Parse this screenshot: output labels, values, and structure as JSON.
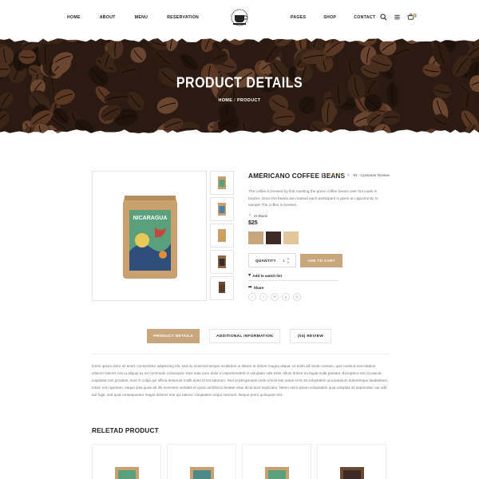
{
  "nav": {
    "left": [
      "HOME",
      "ABOUT",
      "MENU",
      "RESERVATION"
    ],
    "right": [
      "PAGES",
      "SHOP",
      "CONTACT"
    ],
    "icons": [
      "search-icon",
      "menu-icon",
      "cart-icon"
    ],
    "cart_count": "0"
  },
  "banner": {
    "title": "PRODUCT DETAILS",
    "crumb_home": "HOME",
    "crumb_sep": " / ",
    "crumb_current": "PRODUCT"
  },
  "product": {
    "title": "AMERICANO COFFEE BEANS",
    "rating": 3,
    "rating_text": "04 - Customer Review",
    "description": "The coffee is brewed by first roasting the green coffee beans over hot coals in brazier. Once the beans are roasted each participant is given an opportunity to sample The coffee is brewed...",
    "stock": "In Stock",
    "price": "$25",
    "swatches": [
      "#c9a77d",
      "#3b2a26",
      "#e3c79b"
    ],
    "quantity_label": "QUANTITY",
    "quantity_value": "1",
    "add_to_cart": "ADD TO CART",
    "wishlist": "Add to watch list",
    "share": "Share",
    "socials": [
      "twitter-icon",
      "facebook-icon",
      "email-icon",
      "google-plus-icon",
      "link-icon"
    ],
    "package_text": "NICARAGUA"
  },
  "tabs": {
    "items": [
      "PRODUCT DETAILS",
      "ADDITIONAL INFORMATION",
      "(04) REVIEW"
    ],
    "active": 0,
    "body": "lorem ipsum dolor sit amet, consectetur adipisicing elit, sed do eiusmod tempor incididunt ut labore et dolore magna aliqua. Ut enim ad minim veniam, quis nostrud exercitation ullamco laboris nisi ut aliquip ex ea commodo consequat. Duis aute irure dolor in reprehenderit in voluptate velit esse cillum dolore eu fugiat nulla pariatur. Excepteur sint occaecat cupidatat non proident, sunt in culpa qui officia deserunt mollit anim id est laborum. Sed ut perspiciatis unde omnis iste natus error sit voluptatem accusantium doloremque laudantium, totam rem aperiam, eaque ipsa quae ab illo inventore veritatis et quasi architecto beatae vitae dicta sunt explicabo. Nemo enim ipsam voluptatem quia voluptas sit aspernatur aut odit aut fugit, sed quia consequuntur magni dolores eos qui ratione voluptatem sequi nesciunt. Neque porro quisquam est."
  },
  "related": {
    "title": "RELETAD PRODUCT"
  },
  "colors": {
    "accent": "#c9a77d",
    "text": "#222222"
  }
}
